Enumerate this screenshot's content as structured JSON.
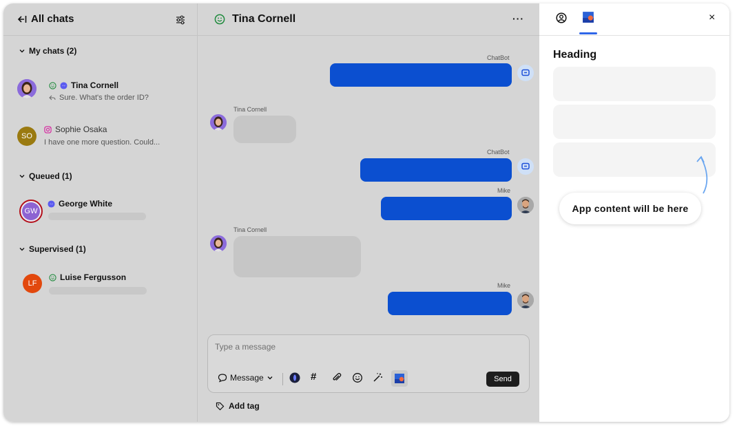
{
  "left_panel": {
    "title": "All chats",
    "sections": {
      "my_chats": "My chats (2)",
      "queued": "Queued (1)",
      "supervised": "Supervised (1)"
    },
    "chats": [
      {
        "name": "Tina Cornell",
        "preview": "Sure. What's the order ID?",
        "channel": "messenger-icon",
        "status": "smile-icon"
      },
      {
        "name": "Sophie Osaka",
        "initials": "SO",
        "preview": "I have one more question. Could...",
        "channel": "instagram-icon"
      },
      {
        "name": "George White",
        "initials": "GW",
        "channel": "messenger-icon"
      },
      {
        "name": "Luise  Fergusson",
        "initials": "LF",
        "status": "smile-icon"
      }
    ]
  },
  "chat": {
    "title": "Tina Cornell",
    "more": "···",
    "messages": [
      {
        "author": "ChatBot",
        "direction": "out"
      },
      {
        "author": "Tina Cornell",
        "direction": "in"
      },
      {
        "author": "ChatBot",
        "direction": "out"
      },
      {
        "author": "Mike",
        "direction": "out"
      },
      {
        "author": "Tina Cornell",
        "direction": "in"
      },
      {
        "author": "Mike",
        "direction": "out"
      }
    ],
    "composer": {
      "placeholder": "Type a message",
      "mode": "Message",
      "send": "Send"
    },
    "add_tag": "Add tag"
  },
  "right_panel": {
    "heading": "Heading",
    "callout": "App content will be here",
    "close": "×"
  },
  "colors": {
    "accent_blue": "#0b4fd0",
    "panel_gray": "#d5d5d5",
    "tab_underline": "#2f66e8"
  }
}
